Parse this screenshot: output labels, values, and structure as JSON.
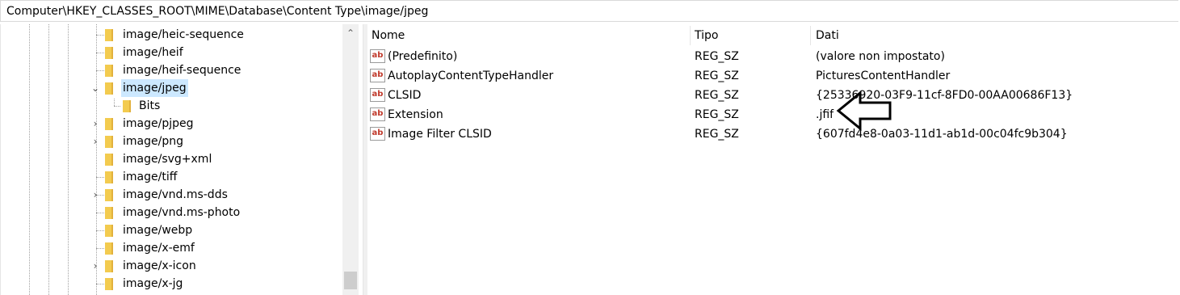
{
  "address": "Computer\\HKEY_CLASSES_ROOT\\MIME\\Database\\Content Type\\image/jpeg",
  "tree": {
    "items": [
      {
        "label": "image/heic-sequence",
        "expandable": false
      },
      {
        "label": "image/heif",
        "expandable": false
      },
      {
        "label": "image/heif-sequence",
        "expandable": false
      },
      {
        "label": "image/jpeg",
        "expandable": true,
        "expanded": true,
        "selected": true
      },
      {
        "label": "Bits",
        "expandable": false,
        "child": true
      },
      {
        "label": "image/pjpeg",
        "expandable": true
      },
      {
        "label": "image/png",
        "expandable": true
      },
      {
        "label": "image/svg+xml",
        "expandable": false
      },
      {
        "label": "image/tiff",
        "expandable": false
      },
      {
        "label": "image/vnd.ms-dds",
        "expandable": true
      },
      {
        "label": "image/vnd.ms-photo",
        "expandable": false
      },
      {
        "label": "image/webp",
        "expandable": false
      },
      {
        "label": "image/x-emf",
        "expandable": false
      },
      {
        "label": "image/x-icon",
        "expandable": true
      },
      {
        "label": "image/x-jg",
        "expandable": false
      }
    ]
  },
  "list": {
    "columns": {
      "name": "Nome",
      "type": "Tipo",
      "data": "Dati"
    },
    "rows": [
      {
        "name": "(Predefinito)",
        "type": "REG_SZ",
        "data": "(valore non impostato)",
        "icon": "string-value-icon"
      },
      {
        "name": "AutoplayContentTypeHandler",
        "type": "REG_SZ",
        "data": "PicturesContentHandler",
        "icon": "string-value-icon"
      },
      {
        "name": "CLSID",
        "type": "REG_SZ",
        "data": "{25336920-03F9-11cf-8FD0-00AA00686F13}",
        "icon": "string-value-icon"
      },
      {
        "name": "Extension",
        "type": "REG_SZ",
        "data": ".jfif",
        "icon": "string-value-icon"
      },
      {
        "name": "Image Filter CLSID",
        "type": "REG_SZ",
        "data": "{607fd4e8-0a03-11d1-ab1d-00c04fc9b304}",
        "icon": "string-value-icon"
      }
    ],
    "icon_text": "ab"
  },
  "colors": {
    "selection": "#cce8ff",
    "folder": "#f3cb4f"
  }
}
